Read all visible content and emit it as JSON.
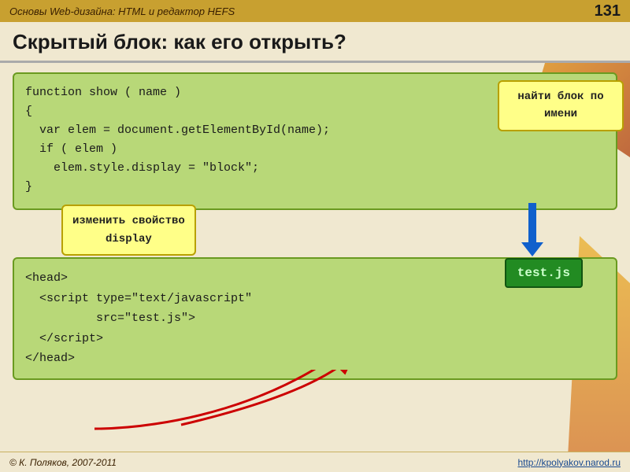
{
  "header": {
    "title": "Основы Web-дизайна: HTML и редактор HEFS",
    "page_number": "131"
  },
  "slide": {
    "title": "Скрытый блок: как его открыть?"
  },
  "code_top": {
    "lines": [
      "function show ( name )",
      "{",
      "  var elem = document.getElementById(name);",
      "  if ( elem )",
      "    elem.style.display = \"block\";",
      "}"
    ]
  },
  "tooltip_right": {
    "text": "найти блок по имени"
  },
  "tooltip_bottom_left": {
    "line1": "изменить свойство",
    "line2": "display"
  },
  "testjs_box": {
    "label": "test.js"
  },
  "code_bottom": {
    "lines": [
      "<head>",
      "  <script type=\"text/javascript\"",
      "          src=\"test.js\">",
      "  <\\/script>",
      "<\\/head>"
    ]
  },
  "footer": {
    "left": "© К. Поляков, 2007-2011",
    "right": "http://kpolyakov.narod.ru"
  }
}
